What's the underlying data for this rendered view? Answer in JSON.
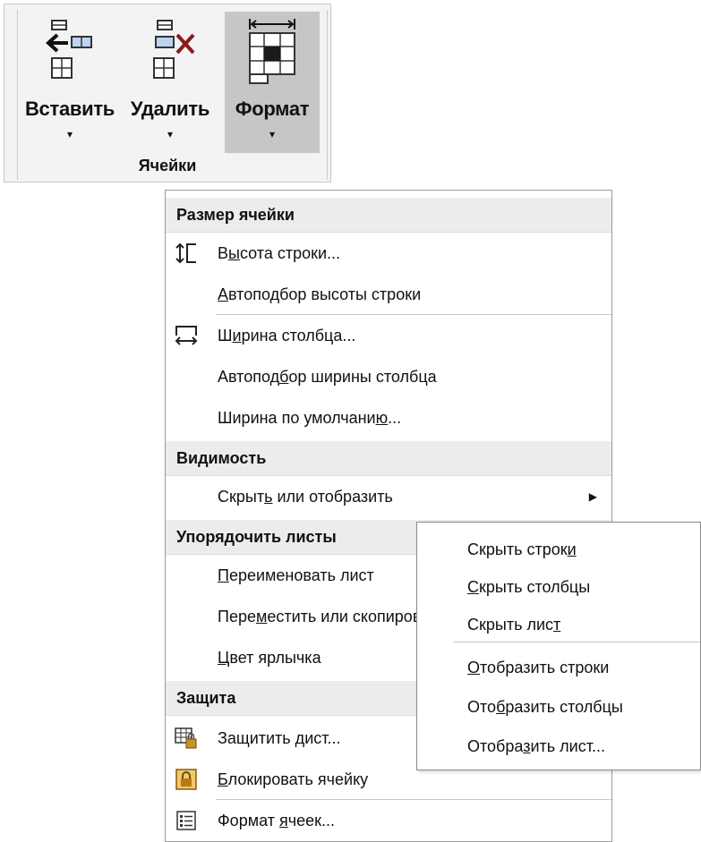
{
  "ribbon": {
    "buttons": [
      {
        "label": "Вставить",
        "icon": "insert-cells-icon"
      },
      {
        "label": "Удалить",
        "icon": "delete-cells-icon"
      },
      {
        "label": "Формат",
        "icon": "format-cells-icon",
        "active": true
      }
    ],
    "drop_glyph": "▾",
    "group_label": "Ячейки"
  },
  "menu": {
    "headers": [
      "Размер ячейки",
      "Видимость",
      "Упорядочить листы",
      "Защита"
    ],
    "cell_size": {
      "row_height": {
        "pre": "В",
        "ul": "ы",
        "post": "сота строки...",
        "icon": "row-height-icon"
      },
      "autofit_row": {
        "pre": "",
        "ul": "А",
        "post": "втоподбор высоты строки"
      },
      "col_width": {
        "pre": "Ш",
        "ul": "и",
        "post": "рина столбца...",
        "icon": "column-width-icon"
      },
      "autofit_col": {
        "pre": "Автопод",
        "ul": "б",
        "post": "ор ширины столбца"
      },
      "default_width": {
        "pre": "Ширина по умолчани",
        "ul": "ю",
        "post": "..."
      }
    },
    "visibility": {
      "hide_show": {
        "pre": "Скрыт",
        "ul": "ь",
        "post": " или отобразить",
        "arrow": "▶"
      }
    },
    "sheets": {
      "rename": {
        "pre": "",
        "ul": "П",
        "post": "ереименовать лист"
      },
      "move_copy": {
        "pre": "Пере",
        "ul": "м",
        "post": "естить или скопировать лист..."
      },
      "tab_color": {
        "pre": "",
        "ul": "Ц",
        "post": "вет ярлычка"
      }
    },
    "protection": {
      "protect_sheet": {
        "pre": "Защитить ",
        "ul": "д",
        "post": "ист...",
        "icon": "protect-sheet-icon"
      },
      "lock_cell": {
        "pre": "",
        "ul": "Б",
        "post": "локировать ячейку",
        "icon": "lock-icon"
      },
      "format_cells": {
        "pre": "Формат ",
        "ul": "я",
        "post": "чеек...",
        "icon": "format-cells-list-icon"
      }
    }
  },
  "submenu": {
    "items": [
      {
        "pre": "Скрыть строк",
        "ul": "и",
        "post": ""
      },
      {
        "pre": "",
        "ul": "С",
        "post": "крыть столбцы"
      },
      {
        "pre": "Скрыть лис",
        "ul": "т",
        "post": ""
      },
      {
        "pre": "",
        "ul": "О",
        "post": "тобразить строки"
      },
      {
        "pre": "Ото",
        "ul": "б",
        "post": "разить столбцы"
      },
      {
        "pre": "Отобра",
        "ul": "з",
        "post": "ить лист..."
      }
    ]
  },
  "colors": {
    "ribbon_bg": "#f3f3f3",
    "active_button": "#c6c6c6",
    "header_bg": "#ececec",
    "lock_icon": "#c8922a"
  }
}
